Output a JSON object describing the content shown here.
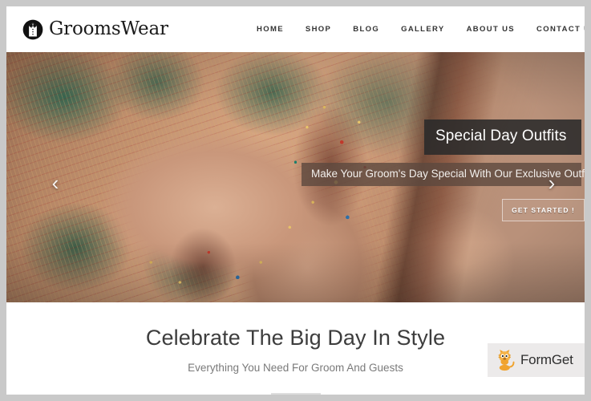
{
  "header": {
    "brand": {
      "name": "GroomsWear",
      "mark_icon": "bowtie-tuxedo-icon"
    },
    "nav": [
      {
        "label": "HOME"
      },
      {
        "label": "SHOP"
      },
      {
        "label": "BLOG"
      },
      {
        "label": "GALLERY"
      },
      {
        "label": "ABOUT US"
      },
      {
        "label": "CONTACT US"
      }
    ]
  },
  "hero": {
    "image_alt": "Close-up of hands in ornate embroidered Indian wedding sherwani with gold and jewel beadwork",
    "slide": {
      "title": "Special Day Outfits",
      "subtitle": "Make Your Groom's Day Special With Our Exclusive Outfits",
      "cta_label": "GET STARTED !"
    },
    "controls": {
      "prev_icon": "chevron-left-icon",
      "prev_glyph": "‹",
      "next_icon": "chevron-right-icon",
      "next_glyph": "›"
    }
  },
  "intro": {
    "title": "Celebrate The Big Day In Style",
    "subtitle": "Everything You Need For Groom And Guests"
  },
  "watermark": {
    "label": "FormGet",
    "mascot_icon": "tiger-mascot-icon"
  },
  "colors": {
    "page_background": "#c9c9c9",
    "content_background": "#ffffff",
    "nav_text": "#333333",
    "caption_box": "#2a2a2a",
    "subtitle_box": "#5c493e",
    "intro_title": "#3d3d3d",
    "intro_subtitle": "#7a7a7a",
    "rule": "#dedede",
    "watermark_background": "#eceaea"
  }
}
